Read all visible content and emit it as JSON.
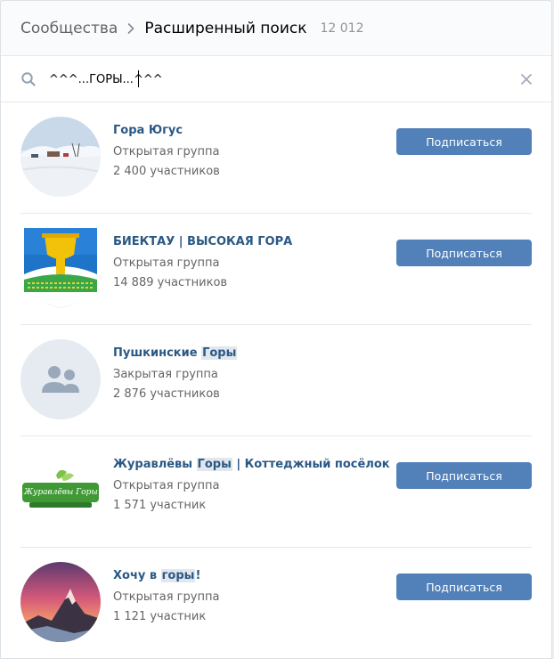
{
  "header": {
    "breadcrumb_root": "Сообщества",
    "title": "Расширенный поиск",
    "count": "12 012"
  },
  "search": {
    "value": "^^^...ГОРЫ...^^^"
  },
  "groups": [
    {
      "name_parts": [
        "Гора Югус"
      ],
      "type": "Открытая группа",
      "members": "2 400 участников",
      "button": "Подписаться",
      "avatar": "snow-landscape"
    },
    {
      "name_parts": [
        "БИЕКТАУ | ВЫСОКАЯ ГОРА"
      ],
      "type": "Открытая группа",
      "members": "14 889 участников",
      "button": "Подписаться",
      "avatar": "coat-of-arms"
    },
    {
      "name_parts": [
        "Пушкинские ",
        "Горы"
      ],
      "type": "Закрытая группа",
      "members": "2 876 участников",
      "button": "",
      "avatar": "default-group-icon"
    },
    {
      "name_parts": [
        "Журавлёвы ",
        "Горы",
        " | Коттеджный посёлок"
      ],
      "type": "Открытая группа",
      "members": "1 571 участник",
      "button": "Подписаться",
      "avatar": "logo",
      "logo_text": "Журавлёвы Горы"
    },
    {
      "name_parts": [
        "Хочу в ",
        "горы",
        "!"
      ],
      "type": "Открытая группа",
      "members": "1 121 участник",
      "button": "Подписаться",
      "avatar": "mountain-sunset"
    }
  ]
}
